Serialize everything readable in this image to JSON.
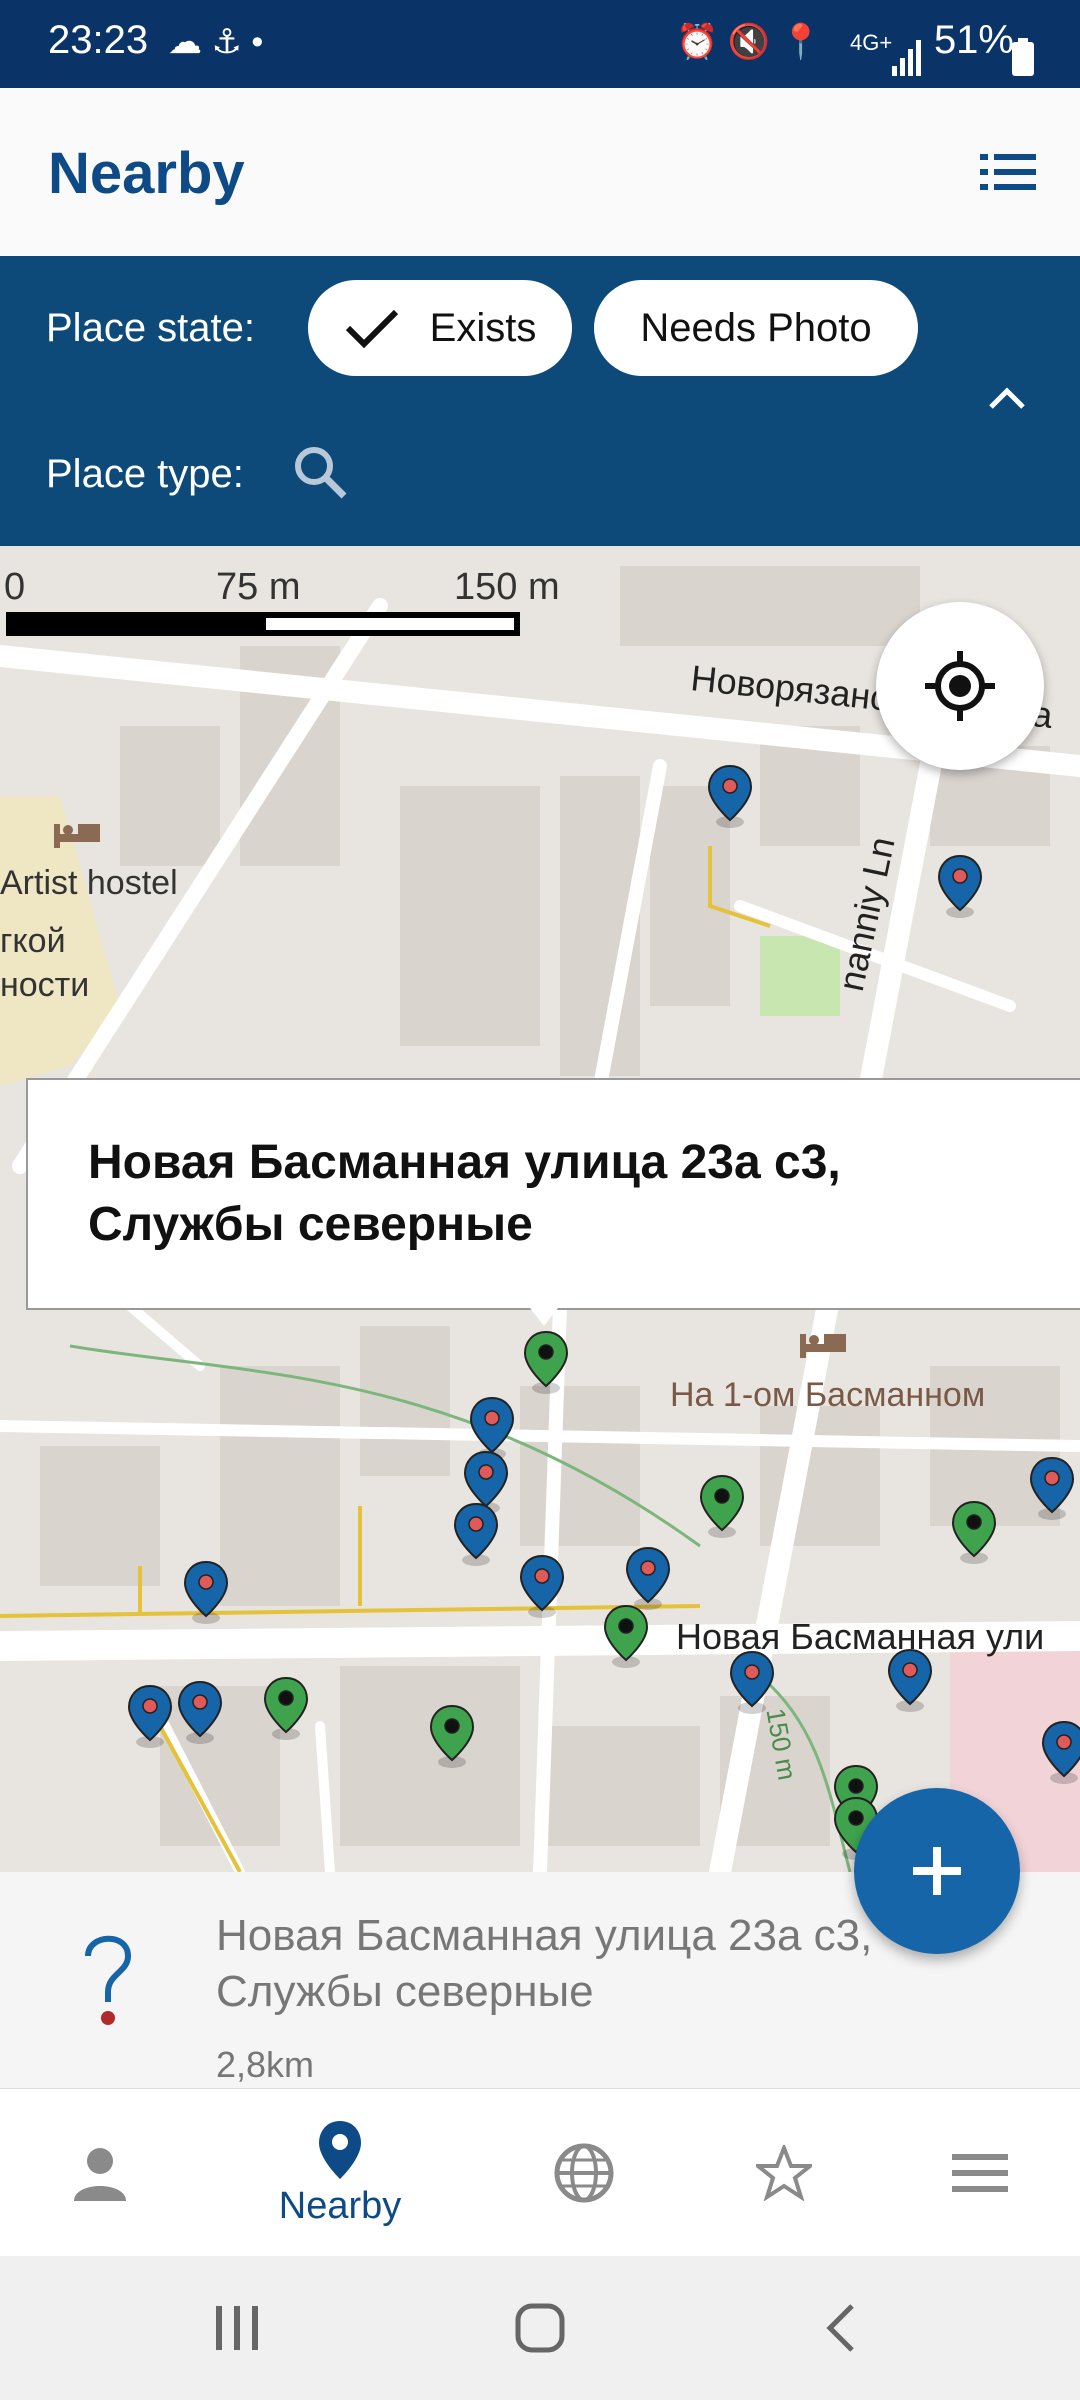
{
  "status_bar": {
    "time": "23:23",
    "battery": "51%",
    "network": "4G+"
  },
  "app_bar": {
    "title": "Nearby",
    "list_icon": "list-icon"
  },
  "filters": {
    "place_state_label": "Place state:",
    "chips": [
      {
        "label": "Exists",
        "checked": true
      },
      {
        "label": "Needs Photo",
        "checked": false
      }
    ],
    "place_type_label": "Place type:"
  },
  "map": {
    "scale_labels": [
      "0",
      "75 m",
      "150 m"
    ],
    "labels": {
      "street_top": "Новорязанская улица",
      "street_lane": "nanniy Ln",
      "hostel": "Artist hostel",
      "area1": "гкой",
      "area2": "ности",
      "hotel": "На 1-ом Басманном",
      "street_bottom": "Новая Басманная ули",
      "distance_marker": "150 m"
    },
    "popup_title": "Новая Басманная улица 23а с3, Службы северные",
    "colors": {
      "blue_pin": "#1565a8",
      "green_pin": "#3fa34d"
    }
  },
  "info_sheet": {
    "name": "Новая Басманная улица 23а с3, Службы северные",
    "distance": "2,8km"
  },
  "bottom_nav": {
    "items": [
      {
        "icon": "person-icon",
        "label": ""
      },
      {
        "icon": "location-pin-icon",
        "label": "Nearby"
      },
      {
        "icon": "globe-icon",
        "label": ""
      },
      {
        "icon": "star-icon",
        "label": ""
      },
      {
        "icon": "menu-icon",
        "label": ""
      }
    ]
  }
}
